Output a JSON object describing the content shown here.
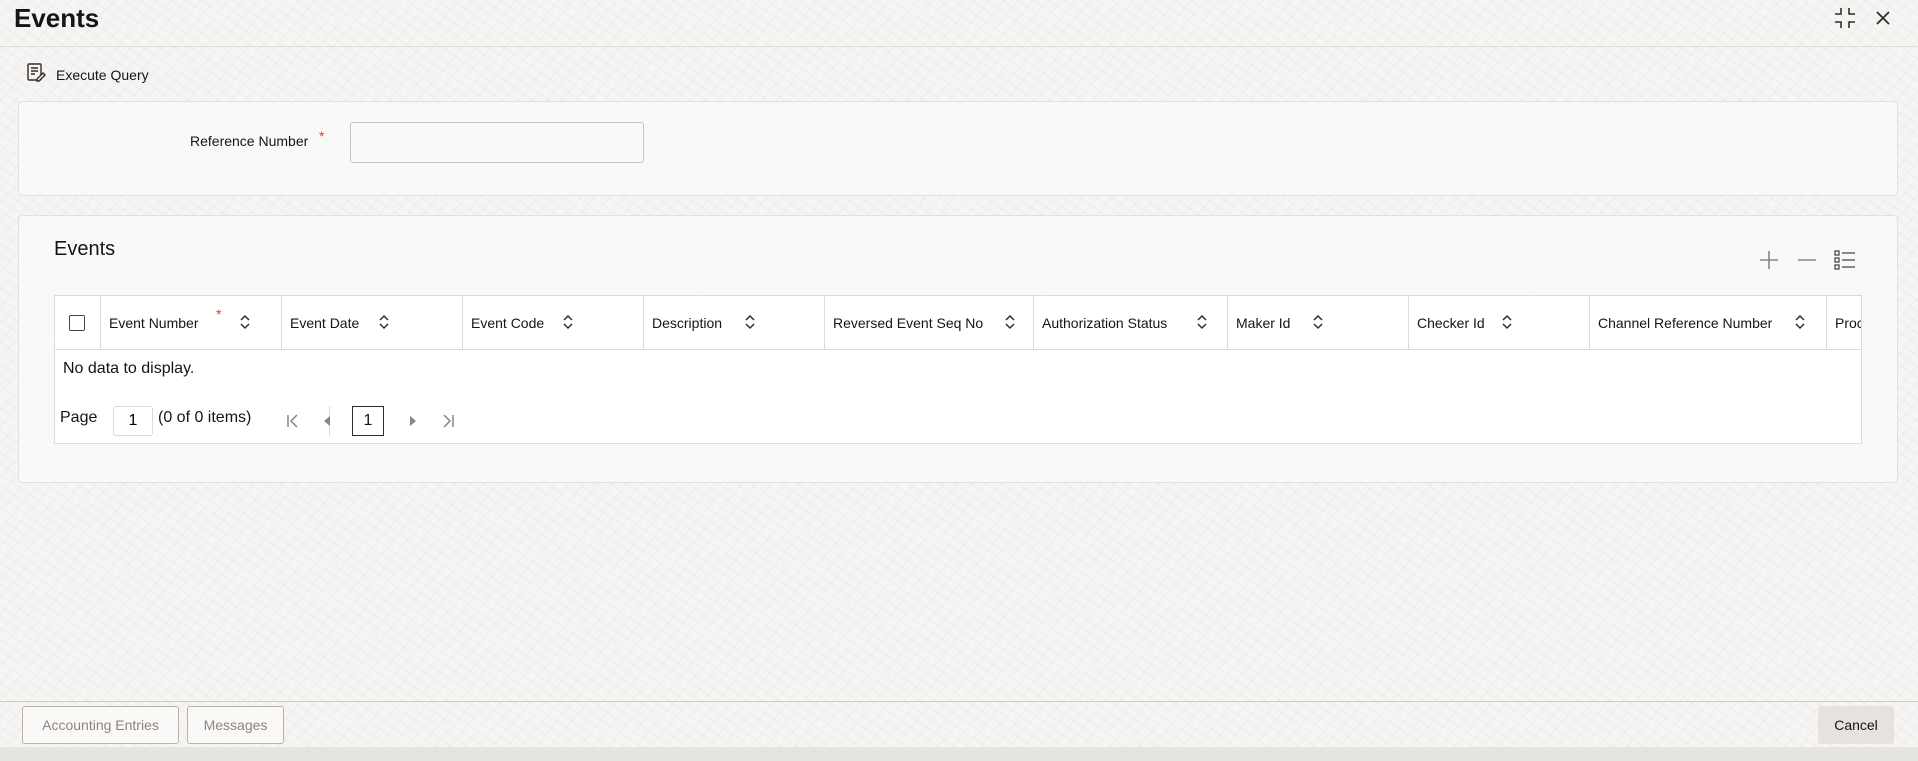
{
  "window": {
    "title": "Events",
    "restore_icon": "restore-window-icon",
    "close_icon": "close-icon"
  },
  "toolbar": {
    "execute_query_label": "Execute Query",
    "execute_query_icon": "query-icon"
  },
  "query_form": {
    "reference_number_label": "Reference Number",
    "required_marker": "*",
    "reference_number_value": ""
  },
  "events_section": {
    "title": "Events",
    "actions": [
      "add-row-icon",
      "delete-row-icon",
      "column-settings-icon"
    ],
    "columns": [
      {
        "label": "Event Number",
        "required": true
      },
      {
        "label": "Event Date"
      },
      {
        "label": "Event Code"
      },
      {
        "label": "Description"
      },
      {
        "label": "Reversed Event Seq No"
      },
      {
        "label": "Authorization Status"
      },
      {
        "label": "Maker Id"
      },
      {
        "label": "Checker Id"
      },
      {
        "label": "Channel Reference Number"
      },
      {
        "label": "Proc"
      }
    ],
    "empty_message": "No data to display.",
    "pagination": {
      "page_label": "Page",
      "page_value": "1",
      "range_text": "(0 of 0 items)",
      "current_page": "1"
    }
  },
  "footer": {
    "accounting_entries_label": "Accounting Entries",
    "messages_label": "Messages",
    "cancel_label": "Cancel"
  },
  "colors": {
    "required": "#c74634",
    "text": "#161513",
    "border": "#dedbd6"
  }
}
